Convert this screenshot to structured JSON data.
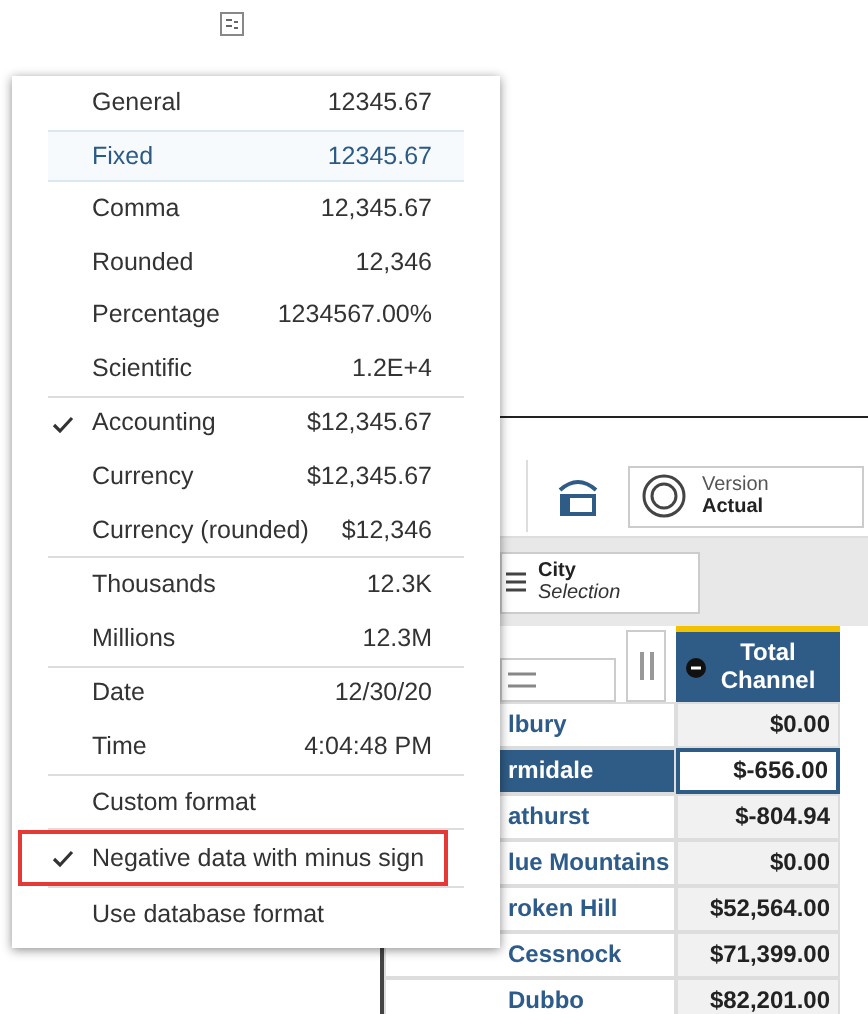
{
  "toolbar": {
    "version_label": "Version",
    "version_value": "Actual"
  },
  "dimension_chip": {
    "title": "City",
    "subtitle": "Selection"
  },
  "table": {
    "header": "Total Channel",
    "rows": [
      {
        "name": "lbury",
        "value": "$0.00",
        "selected": false,
        "focused": false
      },
      {
        "name": "rmidale",
        "value": "$-656.00",
        "selected": true,
        "focused": true
      },
      {
        "name": "athurst",
        "value": "$-804.94",
        "selected": false,
        "focused": false
      },
      {
        "name": "lue Mountains",
        "value": "$0.00",
        "selected": false,
        "focused": false
      },
      {
        "name": "roken Hill",
        "value": "$52,564.00",
        "selected": false,
        "focused": false
      },
      {
        "name": "Cessnock",
        "value": "$71,399.00",
        "selected": false,
        "focused": false
      },
      {
        "name": "Dubbo",
        "value": "$82,201.00",
        "selected": false,
        "focused": false
      }
    ]
  },
  "format_menu": {
    "groups": [
      {
        "items": [
          {
            "label": "General",
            "value": "12345.67",
            "selected": false,
            "checked": false
          },
          {
            "label": "Fixed",
            "value": "12345.67",
            "selected": true,
            "checked": false
          },
          {
            "label": "Comma",
            "value": "12,345.67",
            "selected": false,
            "checked": false
          },
          {
            "label": "Rounded",
            "value": "12,346",
            "selected": false,
            "checked": false
          },
          {
            "label": "Percentage",
            "value": "1234567.00%",
            "selected": false,
            "checked": false
          },
          {
            "label": "Scientific",
            "value": "1.2E+4",
            "selected": false,
            "checked": false
          }
        ]
      },
      {
        "items": [
          {
            "label": "Accounting",
            "value": "$12,345.67",
            "selected": false,
            "checked": true
          },
          {
            "label": "Currency",
            "value": "$12,345.67",
            "selected": false,
            "checked": false
          },
          {
            "label": "Currency (rounded)",
            "value": "$12,346",
            "selected": false,
            "checked": false
          }
        ]
      },
      {
        "items": [
          {
            "label": "Thousands",
            "value": "12.3K",
            "selected": false,
            "checked": false
          },
          {
            "label": "Millions",
            "value": "12.3M",
            "selected": false,
            "checked": false
          }
        ]
      },
      {
        "items": [
          {
            "label": "Date",
            "value": "12/30/20",
            "selected": false,
            "checked": false
          },
          {
            "label": "Time",
            "value": "4:04:48 PM",
            "selected": false,
            "checked": false
          }
        ]
      },
      {
        "items": [
          {
            "label": "Custom format",
            "selected": false,
            "checked": false
          }
        ]
      },
      {
        "items": [
          {
            "label": "Negative data with minus sign",
            "selected": false,
            "checked": true,
            "highlighted": true
          }
        ]
      },
      {
        "items": [
          {
            "label": "Use database format",
            "selected": false,
            "checked": false
          }
        ]
      }
    ]
  }
}
